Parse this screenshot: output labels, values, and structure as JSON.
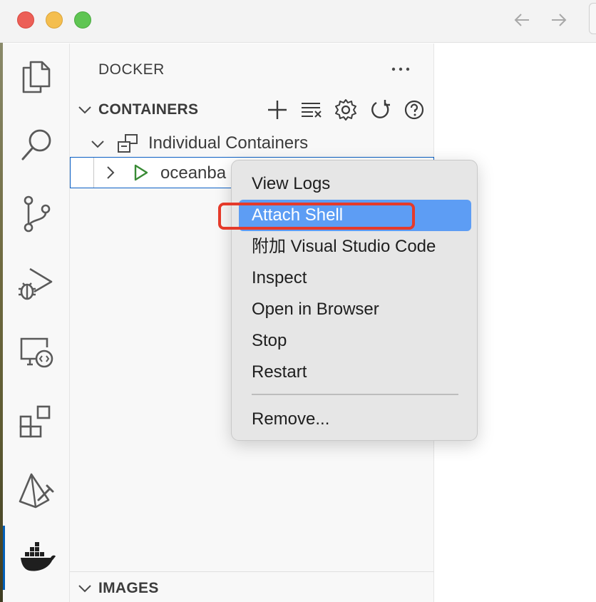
{
  "sidebar": {
    "title": "DOCKER",
    "containers_section": {
      "label": "CONTAINERS",
      "actions": [
        "add-icon",
        "clear-list-icon",
        "gear-icon",
        "refresh-icon",
        "help-icon"
      ]
    },
    "group_label": "Individual Containers",
    "container_label": "oceanba",
    "images_section": {
      "label": "IMAGES"
    }
  },
  "activity_bar": {
    "items": [
      "explorer-icon",
      "search-icon",
      "source-control-icon",
      "run-debug-icon",
      "remote-explorer-icon",
      "extensions-icon",
      "prisma-icon",
      "docker-icon"
    ],
    "active": "docker-icon"
  },
  "context_menu": {
    "items": [
      {
        "label": "View Logs"
      },
      {
        "label": "Attach Shell",
        "highlighted": true
      },
      {
        "label": "附加 Visual Studio Code"
      },
      {
        "label": "Inspect"
      },
      {
        "label": "Open in Browser"
      },
      {
        "label": "Stop"
      },
      {
        "label": "Restart"
      },
      {
        "label": "Remove..."
      }
    ]
  },
  "colors": {
    "accent": "#005fb8",
    "menu_highlight": "#5d9df4",
    "annotation_red": "#e53a2a",
    "running_green": "#388a34"
  }
}
